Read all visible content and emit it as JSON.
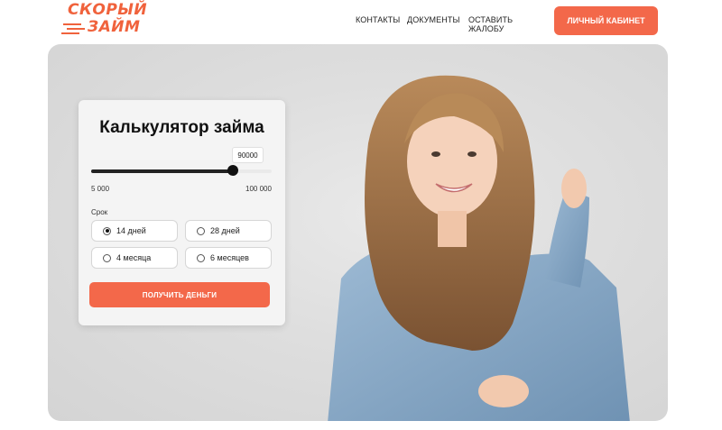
{
  "brand": {
    "line1": "СКОРЫЙ",
    "line2": "ЗАЙМ",
    "color": "#f0623c"
  },
  "nav": {
    "contacts": "КОНТАКТЫ",
    "documents": "ДОКУМЕНТЫ",
    "complaint": "ОСТАВИТЬ ЖАЛОБУ"
  },
  "header": {
    "cabinet_label": "ЛИЧНЫЙ КАБИНЕТ"
  },
  "calculator": {
    "title": "Калькулятор займа",
    "amount": {
      "value": "90000",
      "min_label": "5 000",
      "max_label": "100 000",
      "min": 5000,
      "max": 100000,
      "current": 90000
    },
    "term_label": "Срок",
    "options": [
      {
        "label": "14 дней",
        "selected": true
      },
      {
        "label": "28 дней",
        "selected": false
      },
      {
        "label": "4 месяца",
        "selected": false
      },
      {
        "label": "6 месяцев",
        "selected": false
      }
    ],
    "submit_label": "ПОЛУЧИТЬ ДЕНЬГИ"
  },
  "colors": {
    "accent": "#f3684a",
    "hero_bg": "#dcdcdc"
  }
}
